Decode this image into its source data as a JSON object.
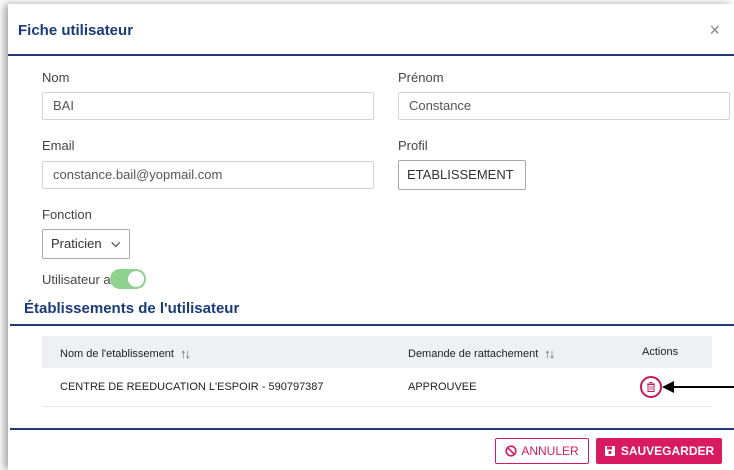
{
  "dialog": {
    "title": "Fiche utilisateur",
    "close_glyph": "×"
  },
  "form": {
    "nom": {
      "label": "Nom",
      "value": "BAI"
    },
    "prenom": {
      "label": "Prénom",
      "value": "Constance"
    },
    "email": {
      "label": "Email",
      "value": "constance.bail@yopmail.com"
    },
    "profil": {
      "label": "Profil",
      "value": "ETABLISSEMENT"
    },
    "fonction": {
      "label": "Fonction",
      "value": "Praticien"
    },
    "actif": {
      "label": "Utilisateur actif",
      "checked": true
    }
  },
  "establishments": {
    "title": "Établissements de l'utilisateur",
    "columns": [
      "Nom de l'etablissement",
      "Demande de rattachement",
      "Actions"
    ],
    "rows": [
      {
        "name": "CENTRE DE REEDUCATION L'ESPOIR - 590797387",
        "status": "APPROUVEE"
      }
    ]
  },
  "buttons": {
    "cancel": "ANNULER",
    "save": "SAUVEGARDER"
  },
  "colors": {
    "primary": "#1f3c7a",
    "accent": "#d81b60",
    "toggle": "#8fd18f"
  },
  "icons": [
    "close-icon",
    "chevron-down-icon",
    "sort-icon",
    "trash-icon",
    "ban-icon",
    "save-icon",
    "arrow-left-icon"
  ]
}
